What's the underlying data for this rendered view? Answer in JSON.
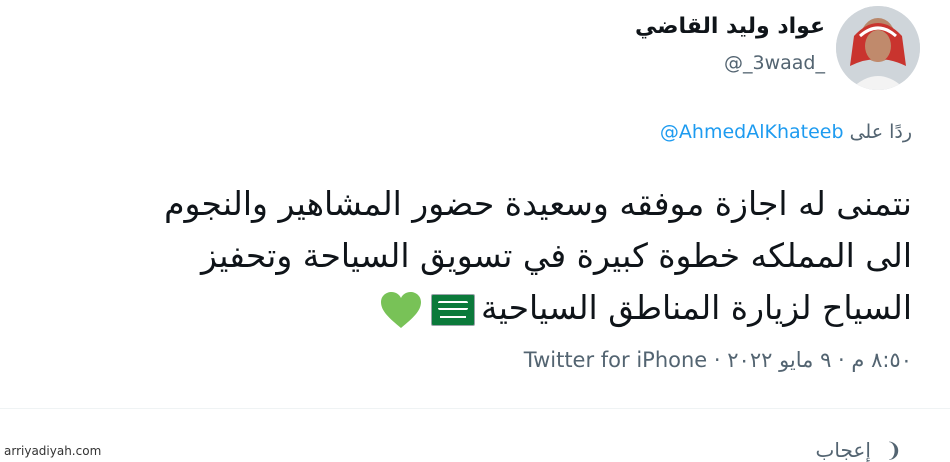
{
  "tweet": {
    "author": {
      "name": "عواد وليد القاضي",
      "handle": "@_3waad_"
    },
    "reply": {
      "prefix": "ردًا على",
      "mention": "@AhmedAlKhateeb"
    },
    "body": {
      "line1": "نتمنى له اجازة  موفقه وسعيدة حضور المشاهير والنجوم",
      "line2": "الى المملكه خطوة كبيرة في تسويق السياحة وتحفيز",
      "line3": "السياح لزيارة المناطق السياحية"
    },
    "emojis": [
      "saudi-flag-emoji",
      "green-heart-emoji"
    ],
    "meta": {
      "time_date": "٨:٥٠ م · ٩ مايو ٢٠٢٢ ·",
      "source": "Twitter for iPhone"
    },
    "likes_label": "إعجاب"
  },
  "watermark": "arriyadiyah.com",
  "colors": {
    "text": "#0f1419",
    "secondary": "#536471",
    "link": "#1d9bf0",
    "heart": "#78c257",
    "flag": "#0b7a3b"
  }
}
